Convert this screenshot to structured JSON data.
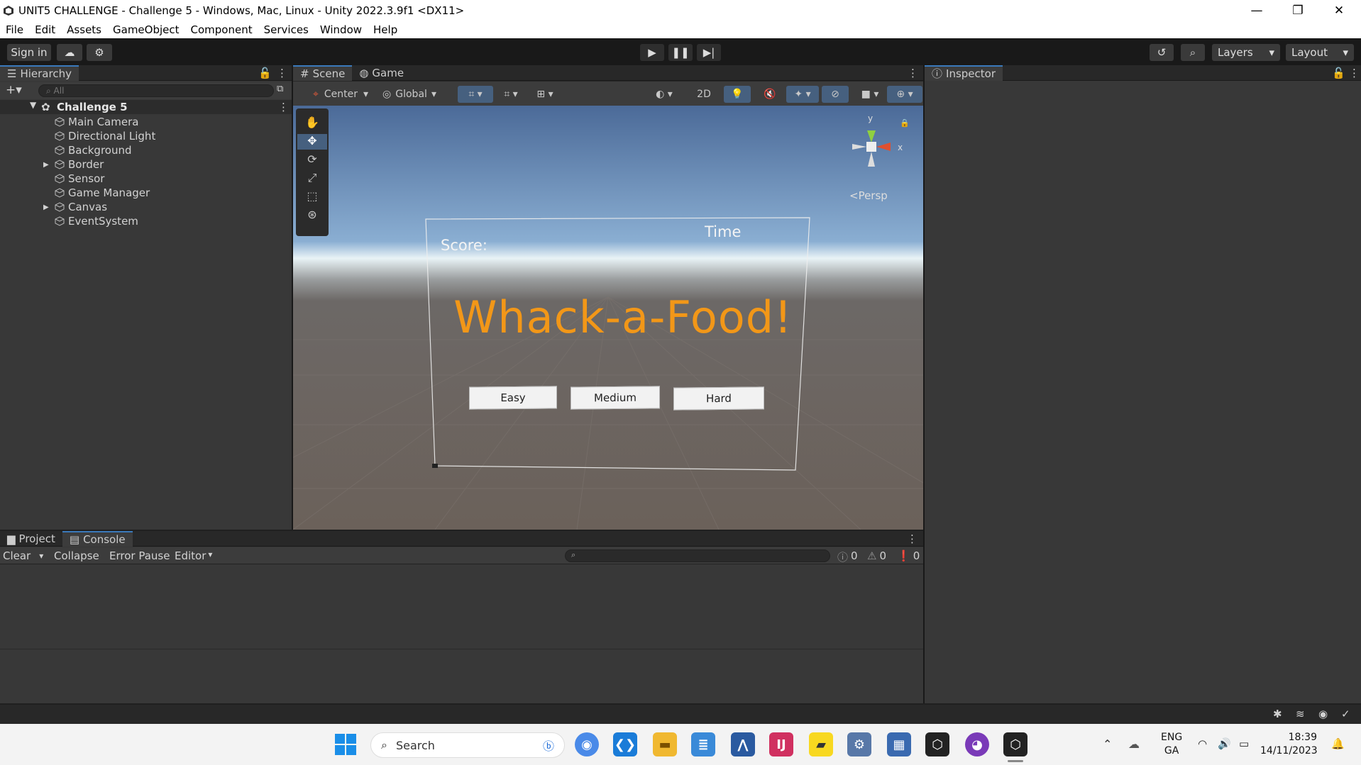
{
  "window": {
    "title": "UNIT5 CHALLENGE - Challenge 5 - Windows, Mac, Linux - Unity 2022.3.9f1 <DX11>"
  },
  "menu": [
    "File",
    "Edit",
    "Assets",
    "GameObject",
    "Component",
    "Services",
    "Window",
    "Help"
  ],
  "toolbar": {
    "sign_in": "Sign in",
    "layers": "Layers",
    "layout": "Layout"
  },
  "hierarchy": {
    "tab": "Hierarchy",
    "search_placeholder": "All",
    "scene": "Challenge 5",
    "items": [
      "Main Camera",
      "Directional Light",
      "Background",
      "Border",
      "Sensor",
      "Game Manager",
      "Canvas",
      "EventSystem"
    ]
  },
  "scene_view": {
    "tabs": [
      "Scene",
      "Game"
    ],
    "pivot": "Center",
    "space": "Global",
    "mode_2d": "2D",
    "persp": "<Persp",
    "axes": {
      "x": "x",
      "y": "y"
    },
    "ui": {
      "score": "Score:",
      "time": "Time",
      "title": "Whack-a-Food!",
      "buttons": [
        "Easy",
        "Medium",
        "Hard"
      ]
    }
  },
  "inspector": {
    "tab": "Inspector"
  },
  "bottom": {
    "tabs": [
      "Project",
      "Console"
    ],
    "clear": "Clear",
    "collapse": "Collapse",
    "error_pause": "Error Pause",
    "editor": "Editor",
    "counts": [
      "0",
      "0",
      "0"
    ]
  },
  "taskbar": {
    "search": "Search",
    "lang": "ENG",
    "lang2": "GA",
    "time": "18:39",
    "date": "14/11/2023"
  },
  "colors": {
    "accent": "#3a79bb",
    "title_orange": "#f29718",
    "panel": "#383838"
  }
}
